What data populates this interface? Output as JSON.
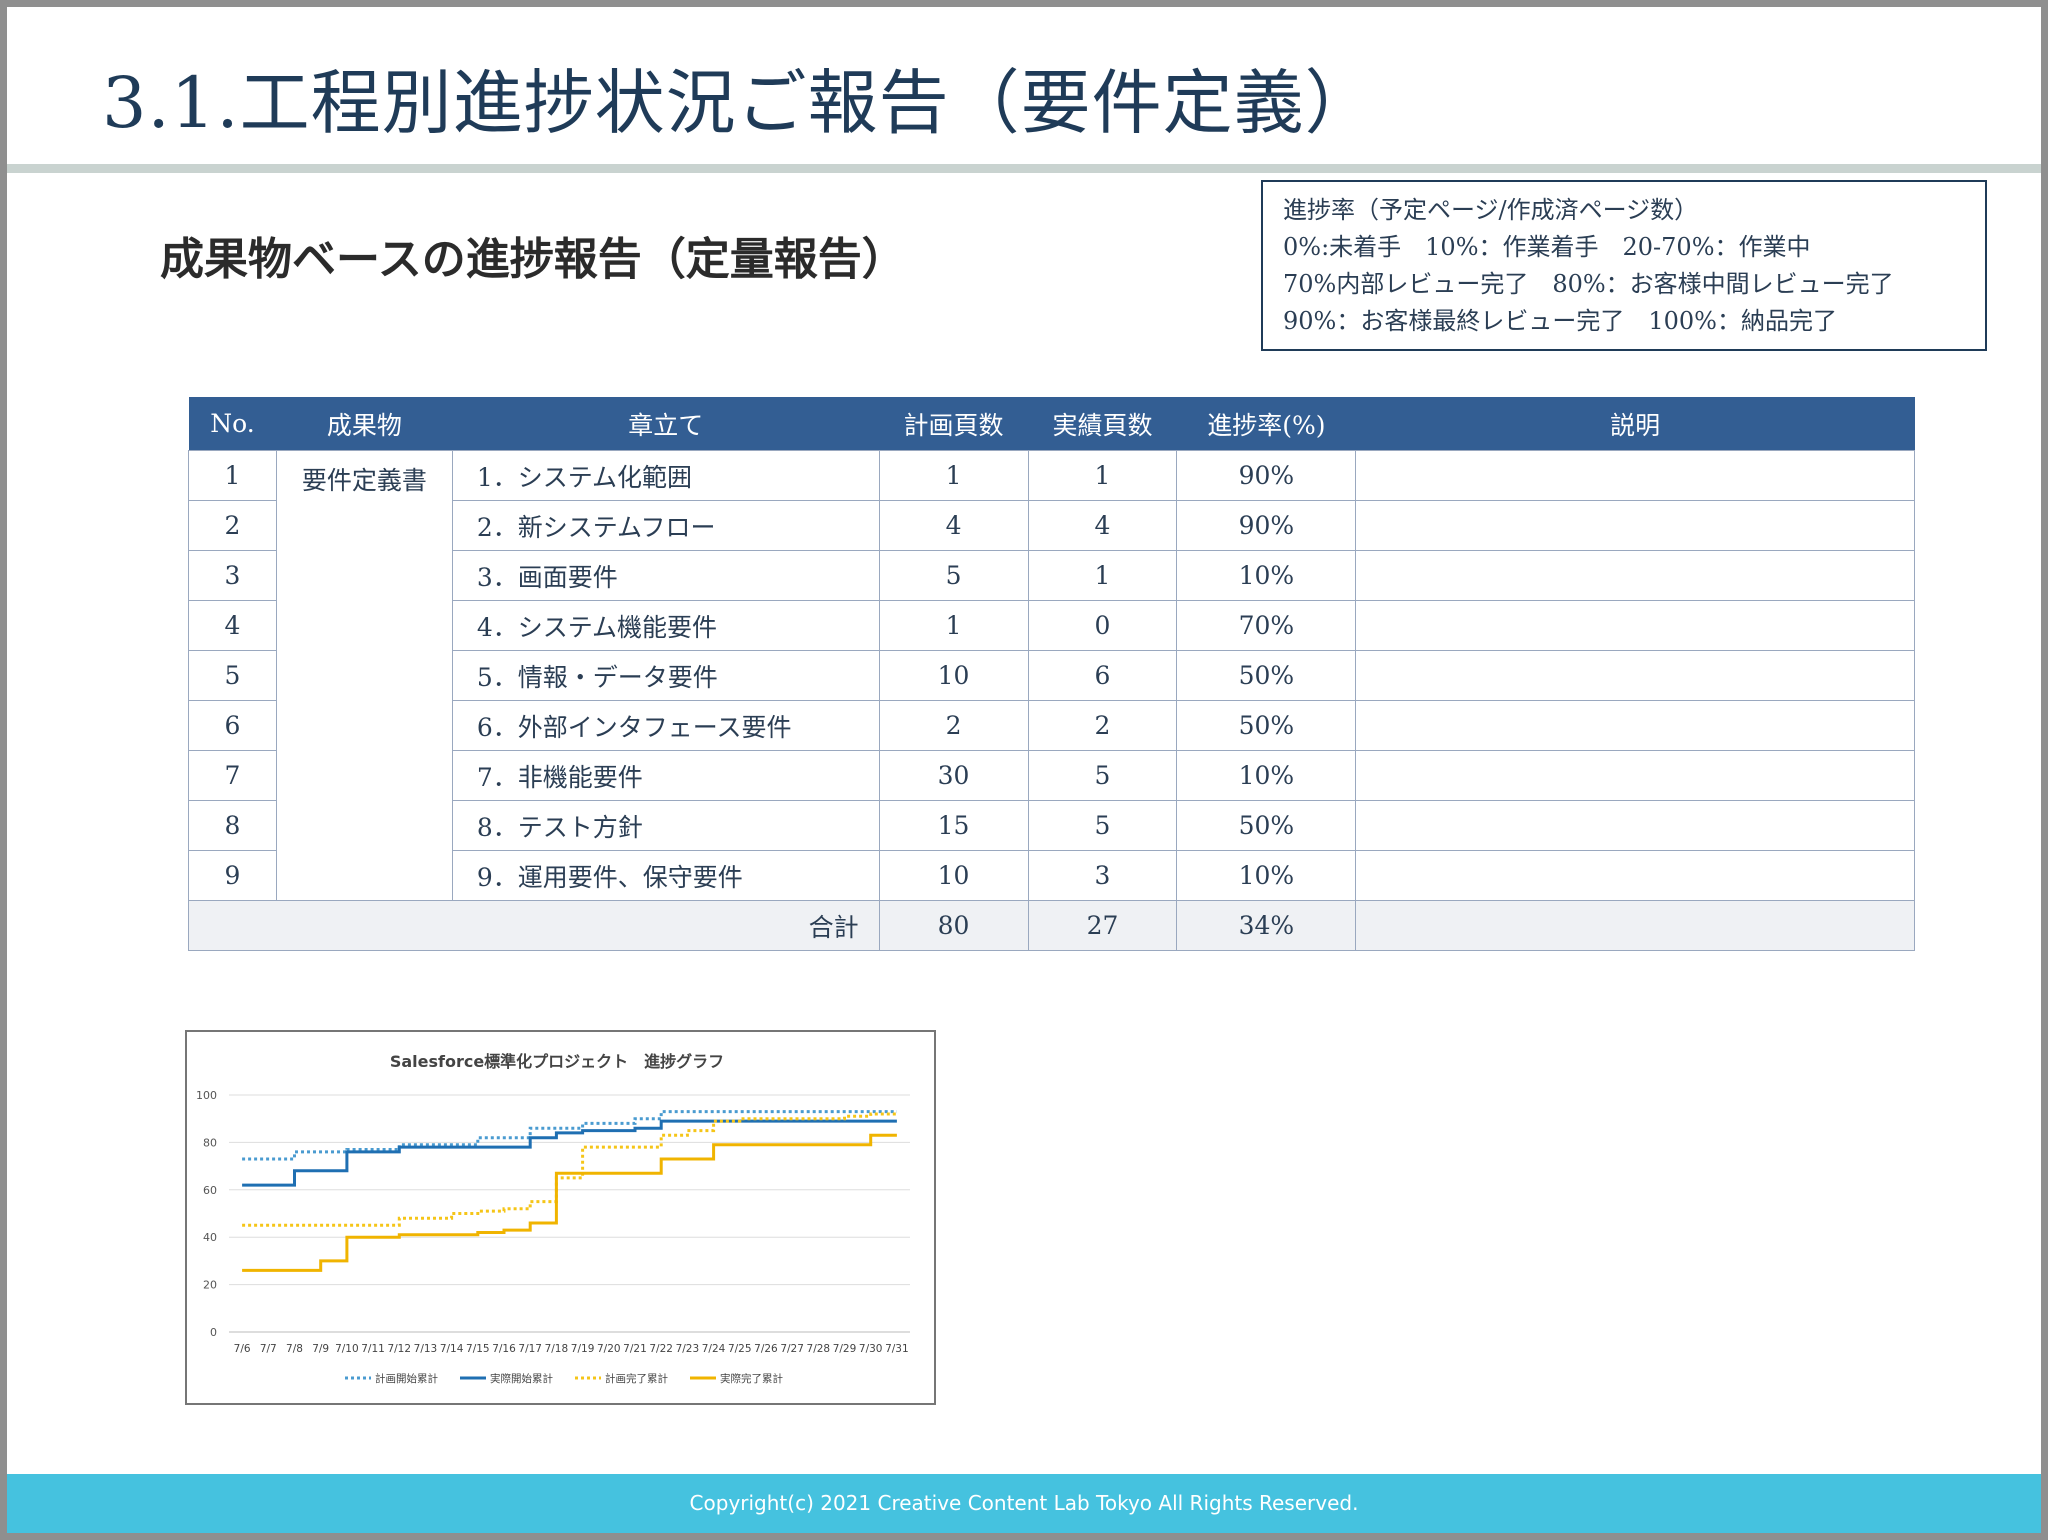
{
  "page": {
    "title": "3.1.工程別進捗状況ご報告（要件定義）",
    "subtitle": "成果物ベースの進捗報告（定量報告）",
    "footer": "Copyright(c) 2021 Creative Content Lab Tokyo All Rights Reserved."
  },
  "legend": {
    "lines": [
      "進捗率（予定ページ/作成済ページ数）",
      "0%:未着手　10%：作業着手　20-70%：作業中",
      "70%内部レビュー完了　80%：お客様中間レビュー完了",
      "90%：お客様最終レビュー完了　100%：納品完了"
    ]
  },
  "table": {
    "headers": [
      "No.",
      "成果物",
      "章立て",
      "計画頁数",
      "実績頁数",
      "進捗率(%)",
      "説明"
    ],
    "deliverable": "要件定義書",
    "rows": [
      {
        "no": "1",
        "chapter": "1．システム化範囲",
        "plan": "1",
        "actual": "1",
        "rate": "90%",
        "note": ""
      },
      {
        "no": "2",
        "chapter": "2．新システムフロー",
        "plan": "4",
        "actual": "4",
        "rate": "90%",
        "note": ""
      },
      {
        "no": "3",
        "chapter": "3．画面要件",
        "plan": "5",
        "actual": "1",
        "rate": "10%",
        "note": ""
      },
      {
        "no": "4",
        "chapter": "4．システム機能要件",
        "plan": "1",
        "actual": "0",
        "rate": "70%",
        "note": ""
      },
      {
        "no": "5",
        "chapter": "5．情報・データ要件",
        "plan": "10",
        "actual": "6",
        "rate": "50%",
        "note": ""
      },
      {
        "no": "6",
        "chapter": "6．外部インタフェース要件",
        "plan": "2",
        "actual": "2",
        "rate": "50%",
        "note": ""
      },
      {
        "no": "7",
        "chapter": "7．非機能要件",
        "plan": "30",
        "actual": "5",
        "rate": "10%",
        "note": ""
      },
      {
        "no": "8",
        "chapter": "8．テスト方針",
        "plan": "15",
        "actual": "5",
        "rate": "50%",
        "note": ""
      },
      {
        "no": "9",
        "chapter": "9．運用要件、保守要件",
        "plan": "10",
        "actual": "3",
        "rate": "10%",
        "note": ""
      }
    ],
    "total": {
      "label": "合計",
      "plan": "80",
      "actual": "27",
      "rate": "34%",
      "note": ""
    }
  },
  "chart_data": {
    "type": "line",
    "title": "Salesforce標準化プロジェクト　進捗グラフ",
    "xlabel": "",
    "ylabel": "",
    "x": [
      "7/6",
      "7/7",
      "7/8",
      "7/9",
      "7/10",
      "7/11",
      "7/12",
      "7/13",
      "7/14",
      "7/15",
      "7/16",
      "7/17",
      "7/18",
      "7/19",
      "7/20",
      "7/21",
      "7/22",
      "7/23",
      "7/24",
      "7/25",
      "7/26",
      "7/27",
      "7/28",
      "7/29",
      "7/30",
      "7/31"
    ],
    "ylim": [
      0,
      100
    ],
    "yticks": [
      0,
      20,
      40,
      60,
      80,
      100
    ],
    "grid": true,
    "legend_position": "bottom",
    "series": [
      {
        "name": "計画開始累計",
        "color": "#4a9bd0",
        "dash": true,
        "values": [
          73,
          73,
          76,
          76,
          77,
          77,
          79,
          79,
          79,
          82,
          82,
          86,
          86,
          88,
          88,
          90,
          93,
          93,
          93,
          93,
          93,
          93,
          93,
          93,
          93,
          93
        ]
      },
      {
        "name": "実際開始累計",
        "color": "#1f6fb2",
        "dash": false,
        "values": [
          62,
          62,
          68,
          68,
          76,
          76,
          78,
          78,
          78,
          78,
          78,
          82,
          84,
          85,
          85,
          86,
          89,
          89,
          89,
          89,
          89,
          89,
          89,
          89,
          89,
          89
        ]
      },
      {
        "name": "計画完了累計",
        "color": "#f5c518",
        "dash": true,
        "values": [
          45,
          45,
          45,
          45,
          45,
          45,
          48,
          48,
          50,
          51,
          52,
          55,
          65,
          78,
          78,
          78,
          83,
          85,
          89,
          90,
          90,
          90,
          90,
          91,
          92,
          92
        ]
      },
      {
        "name": "実際完了累計",
        "color": "#f0b400",
        "dash": false,
        "values": [
          26,
          26,
          26,
          30,
          40,
          40,
          41,
          41,
          41,
          42,
          43,
          46,
          67,
          67,
          67,
          67,
          73,
          73,
          79,
          79,
          79,
          79,
          79,
          79,
          83,
          83
        ]
      }
    ]
  }
}
